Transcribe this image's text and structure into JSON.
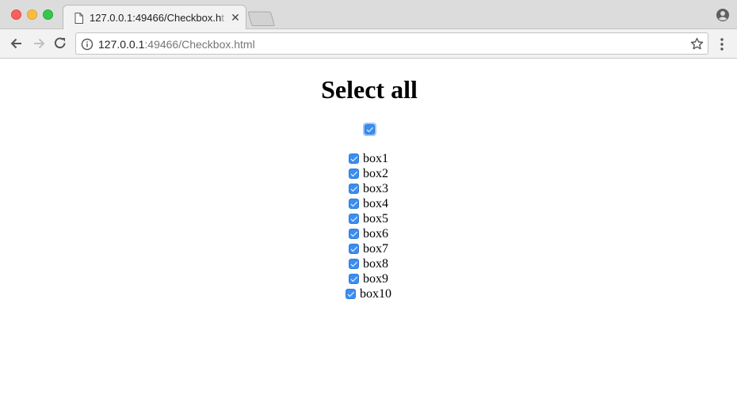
{
  "browser": {
    "tab": {
      "title_main": "127.0.0.1:49466/Checkbox.h",
      "title_faded": "tml",
      "close_glyph": "✕"
    },
    "omnibox": {
      "host": "127.0.0.1",
      "rest": ":49466/Checkbox.html"
    },
    "icons": [
      "page-icon",
      "close-icon",
      "new-tab-icon",
      "profile-icon",
      "back-icon",
      "forward-icon",
      "reload-icon",
      "info-icon",
      "star-icon",
      "menu-icon"
    ],
    "colors": {
      "close": "#fc605c",
      "minimize": "#fdbc40",
      "maximize": "#34c84a"
    }
  },
  "page": {
    "heading": "Select all",
    "select_all": {
      "checked": true
    },
    "items": [
      {
        "label": "box1",
        "checked": true
      },
      {
        "label": "box2",
        "checked": true
      },
      {
        "label": "box3",
        "checked": true
      },
      {
        "label": "box4",
        "checked": true
      },
      {
        "label": "box5",
        "checked": true
      },
      {
        "label": "box6",
        "checked": true
      },
      {
        "label": "box7",
        "checked": true
      },
      {
        "label": "box8",
        "checked": true
      },
      {
        "label": "box9",
        "checked": true
      },
      {
        "label": "box10",
        "checked": true
      }
    ],
    "colors": {
      "checkbox_fill": "#3b8ef1",
      "focus_ring": "#9ecbf7"
    }
  }
}
